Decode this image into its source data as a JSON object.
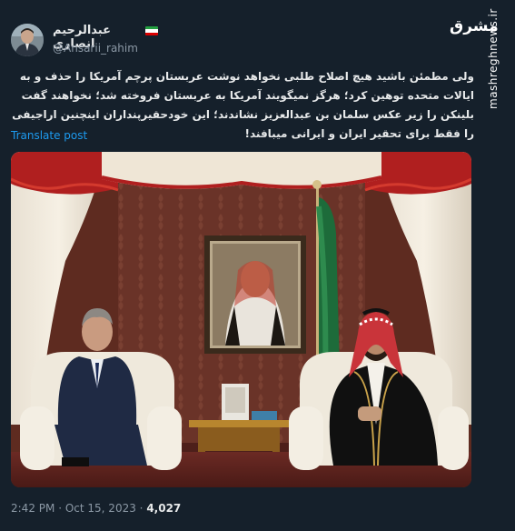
{
  "tweet": {
    "display_name": "عبدالرحیم انصاری",
    "handle": "@Ansarii_rahim",
    "text": "ولی مطمئن باشید هیچ اصلاح طلبی نخواهد نوشت عربستان پرچم آمریکا را حذف و به ایالات متحده توهین کرد؛ هرگز نمیگویند آمریکا به عربستان فروخته شد؛ نخواهند گفت بلینکن را زیر عکس سلمان بن عبدالعزیز نشاندند؛ این خودحقیرپنداران اینچنین اراجیفی را فقط برای تحقیر ایران و ایرانی میبافند!",
    "translate_label": "Translate post",
    "time": "2:42 PM",
    "date": "Oct 15, 2023",
    "views_count": "4,027",
    "separator": "·"
  },
  "watermark": {
    "logo_text": "مشرق",
    "url": "mashreghnews.ir"
  },
  "colors": {
    "background": "#15202b",
    "text": "#e7e9ea",
    "secondary": "#8b98a5",
    "link": "#1d9bf0"
  },
  "icons": {
    "flag": "iran-flag-icon"
  }
}
